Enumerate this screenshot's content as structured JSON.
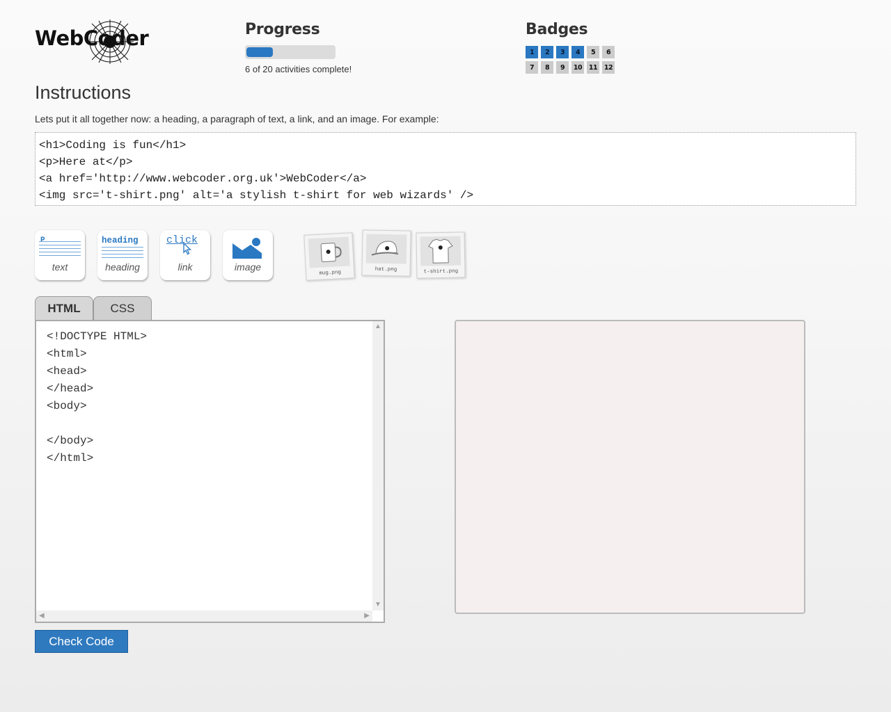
{
  "brand": {
    "logo_text": "WebCoder"
  },
  "progress": {
    "heading": "Progress",
    "completed": 6,
    "total": 20,
    "label": "6 of 20 activities complete!"
  },
  "badges": {
    "heading": "Badges",
    "items": [
      {
        "label": "1",
        "earned": true
      },
      {
        "label": "2",
        "earned": true
      },
      {
        "label": "3",
        "earned": true
      },
      {
        "label": "4",
        "earned": true
      },
      {
        "label": "5",
        "earned": false
      },
      {
        "label": "6",
        "earned": false
      },
      {
        "label": "7",
        "earned": false
      },
      {
        "label": "8",
        "earned": false
      },
      {
        "label": "9",
        "earned": false
      },
      {
        "label": "10",
        "earned": false
      },
      {
        "label": "11",
        "earned": false
      },
      {
        "label": "12",
        "earned": false
      }
    ]
  },
  "instructions": {
    "heading": "Instructions",
    "text": "Lets put it all together now: a heading, a paragraph of text, a link, and an image. For example:",
    "example_lines": [
      "<h1>Coding is fun</h1>",
      "<p>Here at</p>",
      "<a href='http://www.webcoder.org.uk'>WebCoder</a>",
      "<img src='t-shirt.png' alt='a stylish t-shirt for web wizards' />"
    ]
  },
  "tools": {
    "text": {
      "icon_word": "P",
      "label": "text",
      "icon": "paragraph-icon"
    },
    "heading": {
      "icon_word": "heading",
      "label": "heading",
      "icon": "heading-icon"
    },
    "link": {
      "icon_word": "click",
      "label": "link",
      "icon": "link-cursor-icon"
    },
    "image": {
      "label": "image",
      "icon": "image-icon"
    }
  },
  "assets": [
    {
      "caption": "mug.png",
      "icon": "mug-icon"
    },
    {
      "caption": "hat.png",
      "icon": "cap-icon"
    },
    {
      "caption": "t-shirt.png",
      "icon": "tshirt-icon"
    }
  ],
  "editor": {
    "tabs": [
      "HTML",
      "CSS"
    ],
    "active_tab": "HTML",
    "code": "<!DOCTYPE HTML>\n<html>\n<head>\n</head>\n<body>\n\n</body>\n</html>"
  },
  "actions": {
    "check_label": "Check Code"
  },
  "colors": {
    "accent": "#2a78c2",
    "badge_off": "#cbcbcb",
    "preview_bg": "#f5f0ef"
  }
}
